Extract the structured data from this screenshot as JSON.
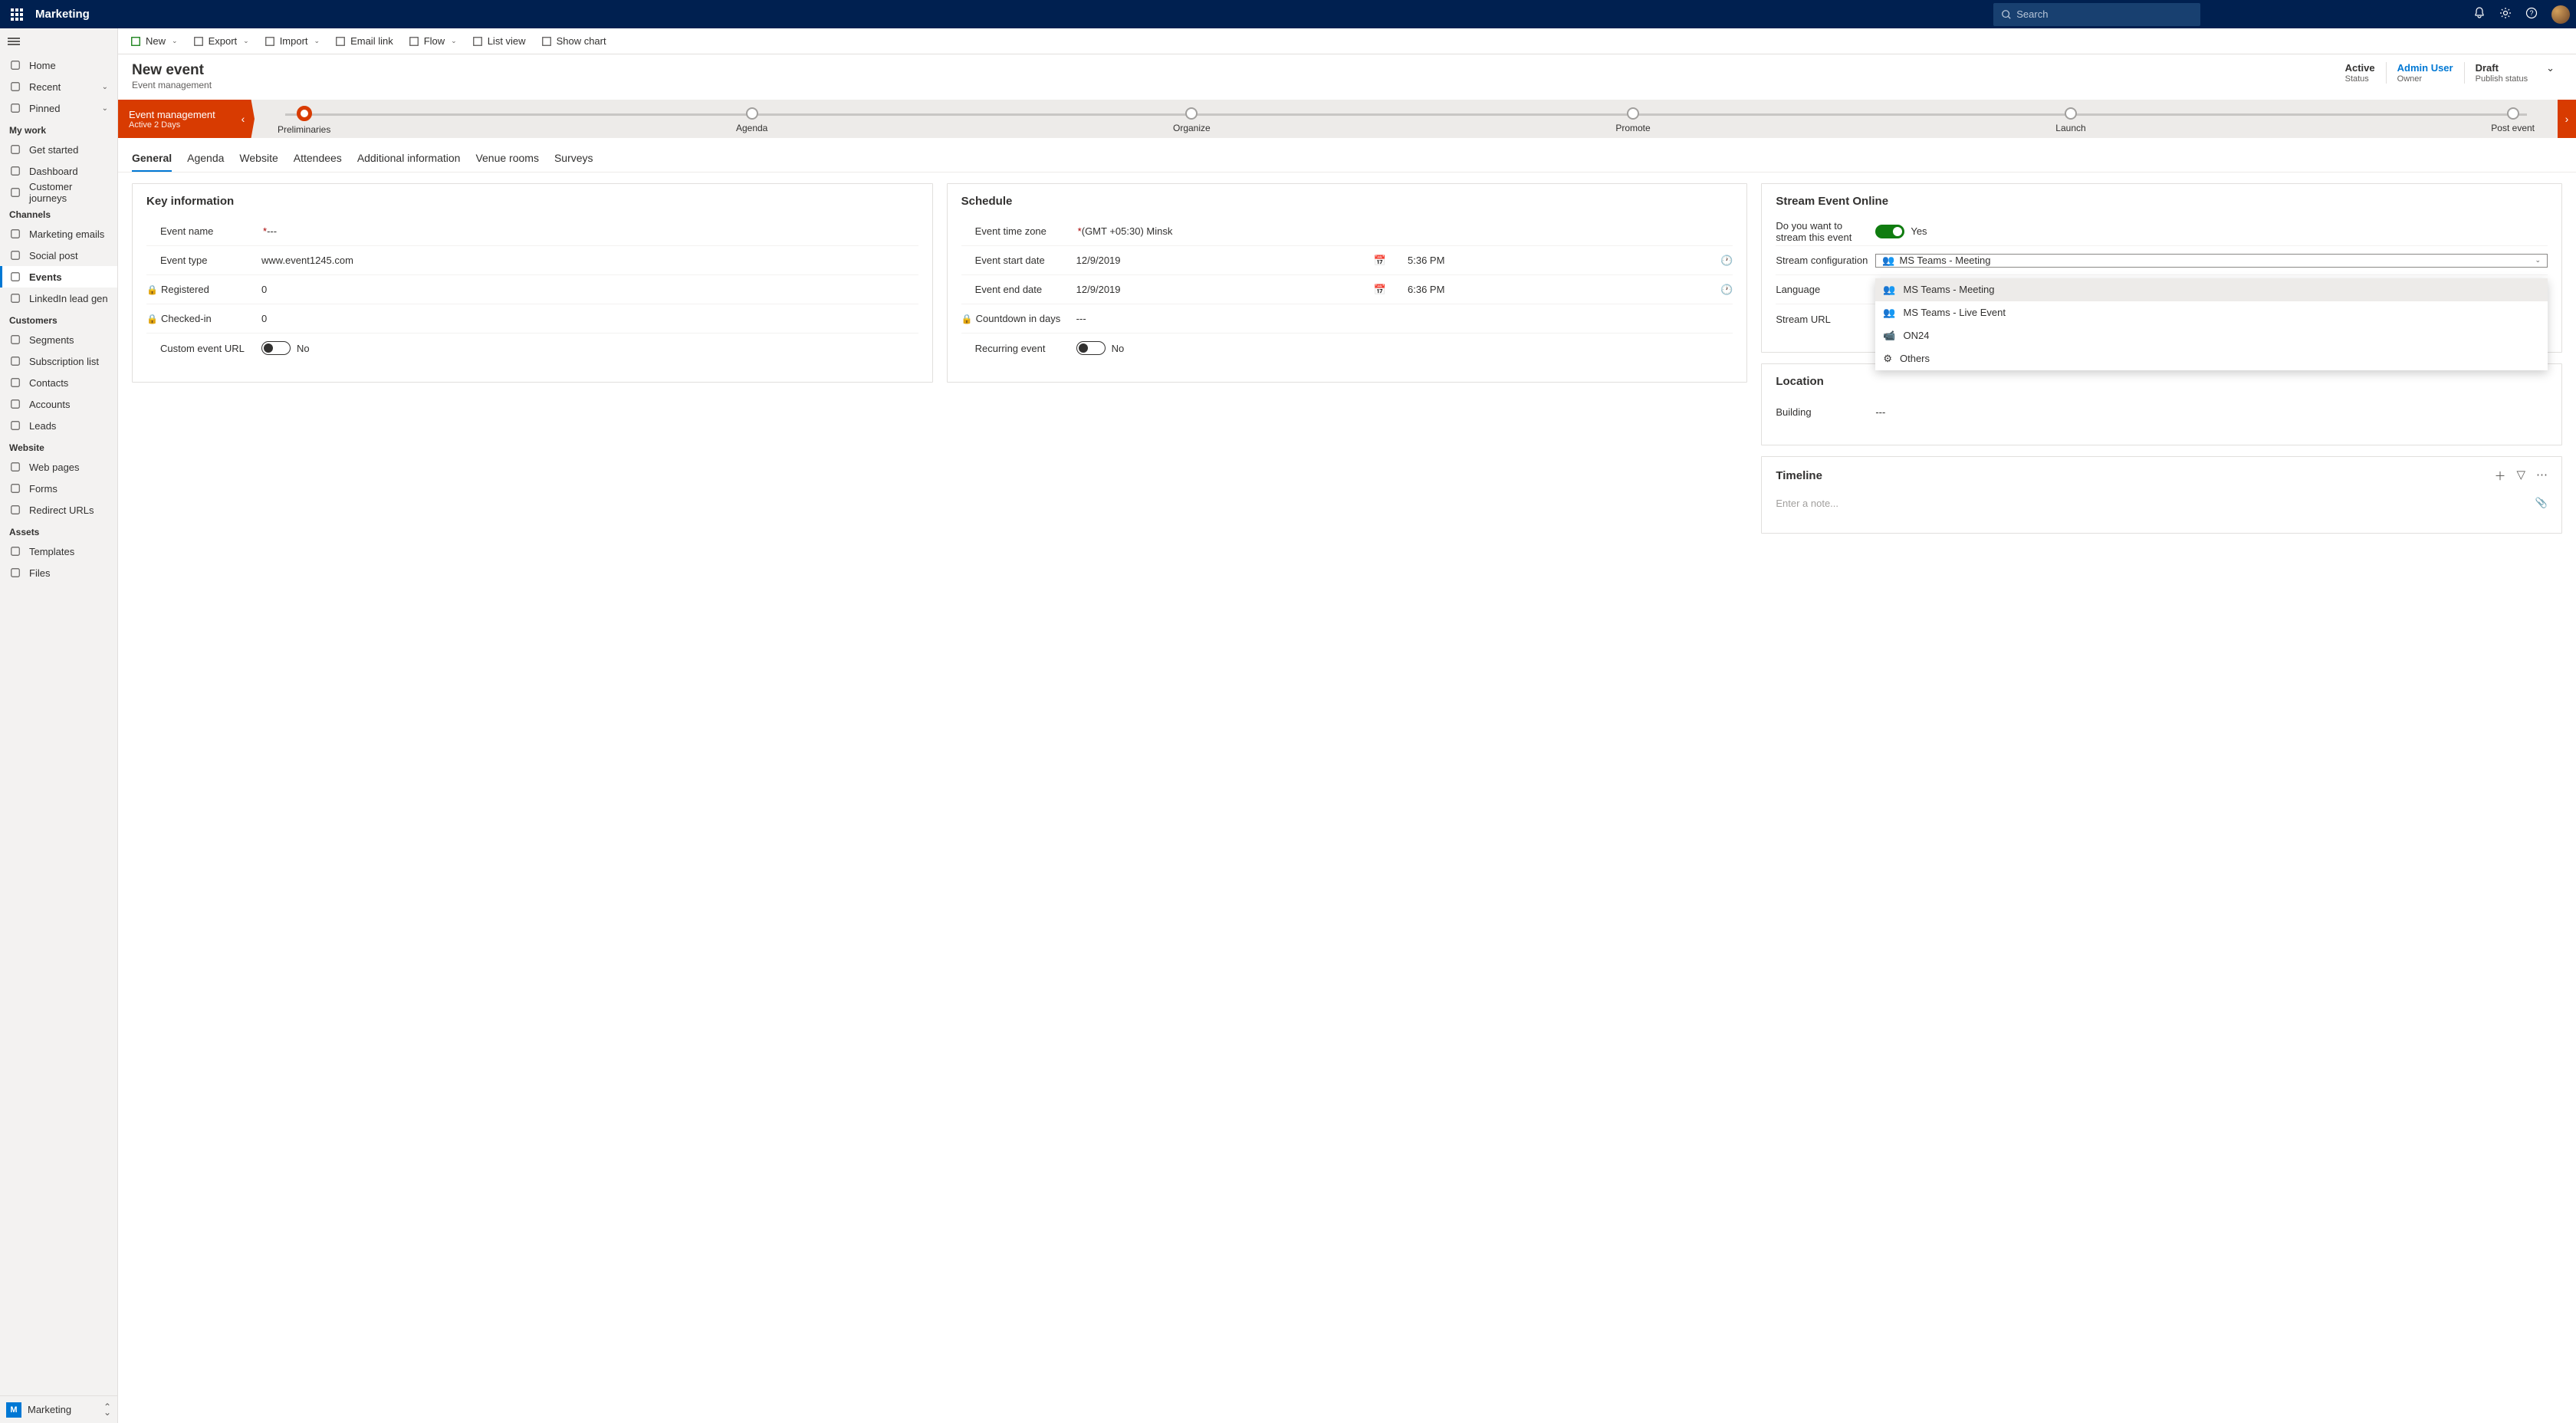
{
  "header": {
    "app_title": "Marketing",
    "search_placeholder": "Search"
  },
  "sidebar": {
    "top": [
      {
        "icon": "home",
        "label": "Home"
      },
      {
        "icon": "clock",
        "label": "Recent",
        "chevron": true
      },
      {
        "icon": "pin",
        "label": "Pinned",
        "chevron": true
      }
    ],
    "groups": [
      {
        "title": "My work",
        "items": [
          {
            "icon": "play",
            "label": "Get started"
          },
          {
            "icon": "grid",
            "label": "Dashboard"
          },
          {
            "icon": "journey",
            "label": "Customer journeys"
          }
        ]
      },
      {
        "title": "Channels",
        "items": [
          {
            "icon": "mail",
            "label": "Marketing emails"
          },
          {
            "icon": "globe",
            "label": "Social post"
          },
          {
            "icon": "calendar",
            "label": "Events",
            "active": true
          },
          {
            "icon": "linkedin",
            "label": "LinkedIn lead gen"
          }
        ]
      },
      {
        "title": "Customers",
        "items": [
          {
            "icon": "pie",
            "label": "Segments"
          },
          {
            "icon": "list",
            "label": "Subscription list"
          },
          {
            "icon": "person",
            "label": "Contacts"
          },
          {
            "icon": "building",
            "label": "Accounts"
          },
          {
            "icon": "leads",
            "label": "Leads"
          }
        ]
      },
      {
        "title": "Website",
        "items": [
          {
            "icon": "page",
            "label": "Web pages"
          },
          {
            "icon": "form",
            "label": "Forms"
          },
          {
            "icon": "redirect",
            "label": "Redirect URLs"
          }
        ]
      },
      {
        "title": "Assets",
        "items": [
          {
            "icon": "template",
            "label": "Templates"
          },
          {
            "icon": "files",
            "label": "Files"
          }
        ]
      }
    ],
    "env_badge": "M",
    "env_name": "Marketing"
  },
  "commandbar": [
    {
      "icon": "plus",
      "label": "New",
      "chevron": true,
      "color": "#107c10"
    },
    {
      "icon": "xls",
      "label": "Export",
      "chevron": true
    },
    {
      "icon": "xlsi",
      "label": "Import",
      "chevron": true
    },
    {
      "icon": "email",
      "label": "Email link"
    },
    {
      "icon": "flow",
      "label": "Flow",
      "chevron": true
    },
    {
      "icon": "listv",
      "label": "List view"
    },
    {
      "icon": "chart",
      "label": "Show chart"
    }
  ],
  "page": {
    "title": "New event",
    "subtitle": "Event management",
    "status": [
      {
        "value": "Active",
        "label": "Status"
      },
      {
        "value": "Admin User",
        "label": "Owner",
        "link": true
      },
      {
        "value": "Draft",
        "label": "Publish status"
      }
    ]
  },
  "stages": {
    "current_title": "Event management",
    "current_sub": "Active 2 Days",
    "steps": [
      "Preliminaries",
      "Agenda",
      "Organize",
      "Promote",
      "Launch",
      "Post event"
    ],
    "active_index": 0
  },
  "tabs": [
    "General",
    "Agenda",
    "Website",
    "Attendees",
    "Additional information",
    "Venue rooms",
    "Surveys"
  ],
  "active_tab": 0,
  "key_info": {
    "title": "Key information",
    "event_name_label": "Event name",
    "event_name_value": "---",
    "event_type_label": "Event type",
    "event_type_value": "www.event1245.com",
    "registered_label": "Registered",
    "registered_value": "0",
    "checkedin_label": "Checked-in",
    "checkedin_value": "0",
    "custom_url_label": "Custom event URL",
    "custom_url_value": "No"
  },
  "schedule": {
    "title": "Schedule",
    "tz_label": "Event time zone",
    "tz_value": "(GMT +05:30) Minsk",
    "start_label": "Event start date",
    "start_date": "12/9/2019",
    "start_time": "5:36 PM",
    "end_label": "Event end date",
    "end_date": "12/9/2019",
    "end_time": "6:36 PM",
    "countdown_label": "Countdown in days",
    "countdown_value": "---",
    "recurring_label": "Recurring event",
    "recurring_value": "No"
  },
  "stream": {
    "title": "Stream Event Online",
    "q_label": "Do you want to stream this event",
    "q_value": "Yes",
    "config_label": "Stream configuration",
    "config_value": "MS Teams - Meeting",
    "options": [
      "MS Teams - Meeting",
      "MS Teams - Live Event",
      "ON24",
      "Others"
    ],
    "language_label": "Language",
    "url_label": "Stream URL"
  },
  "location": {
    "title": "Location",
    "building_label": "Building",
    "building_value": "---"
  },
  "timeline": {
    "title": "Timeline",
    "placeholder": "Enter a note..."
  }
}
